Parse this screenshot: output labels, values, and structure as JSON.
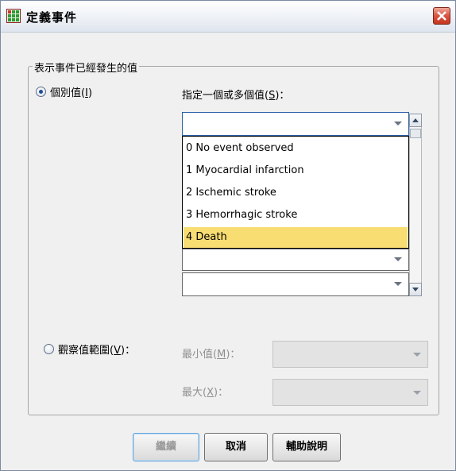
{
  "dialog": {
    "title": "定義事件",
    "group_title": "表示事件已經發生的值"
  },
  "individual": {
    "label": "個別值",
    "mnemonic": "I",
    "selected": true,
    "values_label": "指定一個或多個值",
    "values_mnemonic": "S",
    "current_value": "",
    "options": [
      "0 No event observed",
      "1 Myocardial infarction",
      "2 Ischemic stroke",
      "3 Hemorrhagic stroke",
      "4 Death"
    ],
    "highlighted": "4 Death",
    "highlight_color": "#f8dd72"
  },
  "range": {
    "label": "觀察值範圍",
    "mnemonic": "V",
    "selected": false,
    "min_label": "最小值",
    "min_mnemonic": "M",
    "max_label": "最大",
    "max_mnemonic": "X",
    "enabled": false
  },
  "buttons": {
    "continue_label": "繼續",
    "cancel_label": "取消",
    "help_label": "輔助說明"
  },
  "icons": {
    "app": "spss-grid-icon",
    "close": "close-icon"
  }
}
